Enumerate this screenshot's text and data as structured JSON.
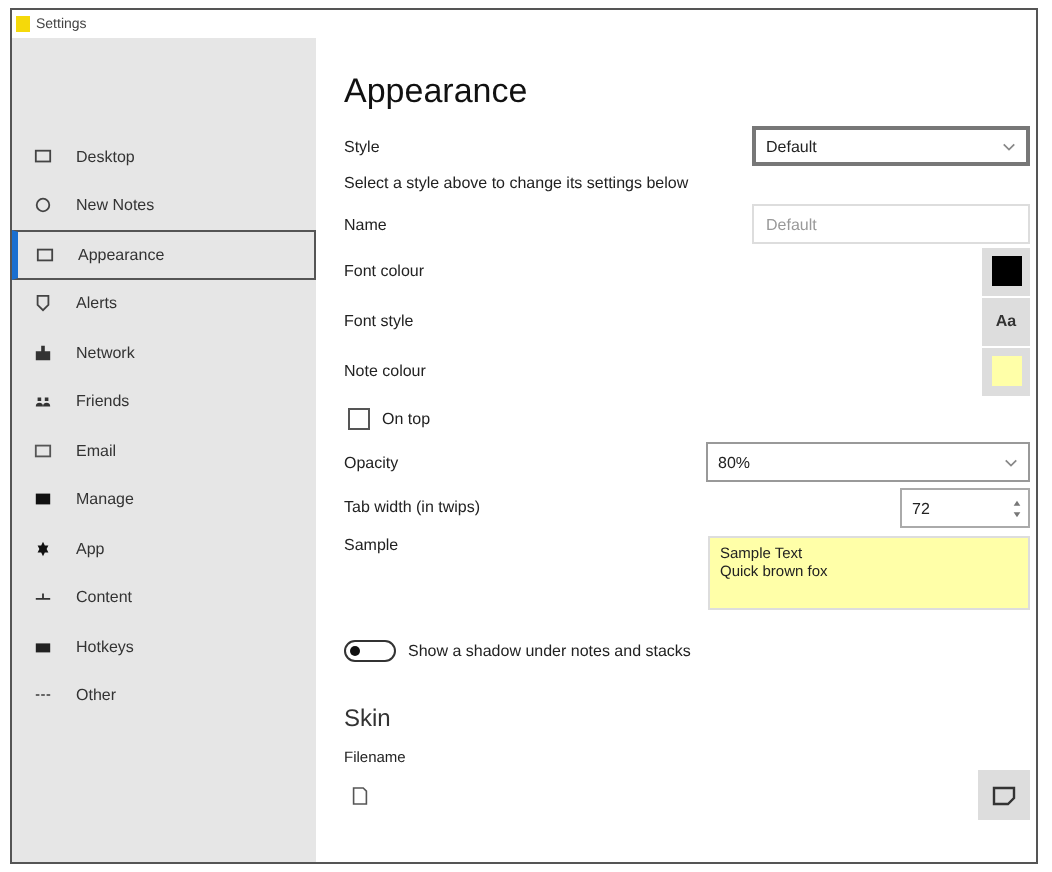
{
  "window": {
    "title": "Settings"
  },
  "sidebar": {
    "items": [
      {
        "label": "Desktop",
        "selected": false
      },
      {
        "label": "New Notes",
        "selected": false
      },
      {
        "label": "Appearance",
        "selected": true
      },
      {
        "label": "Alerts",
        "selected": false
      },
      {
        "label": "Network",
        "selected": false
      },
      {
        "label": "Friends",
        "selected": false
      },
      {
        "label": "Email",
        "selected": false
      },
      {
        "label": "Manage",
        "selected": false
      },
      {
        "label": "App",
        "selected": false
      },
      {
        "label": "Content",
        "selected": false
      },
      {
        "label": "Hotkeys",
        "selected": false
      },
      {
        "label": "Other",
        "selected": false
      }
    ]
  },
  "page": {
    "heading": "Appearance",
    "style": {
      "label": "Style",
      "value": "Default"
    },
    "hint": "Select a style above to change its settings below",
    "name": {
      "label": "Name",
      "placeholder": "Default"
    },
    "font_colour": {
      "label": "Font colour",
      "color": "#000000"
    },
    "font_style": {
      "label": "Font style",
      "button": "Aa"
    },
    "note_colour": {
      "label": "Note colour",
      "color": "#ffffa8"
    },
    "on_top": {
      "label": "On top",
      "checked": false
    },
    "opacity": {
      "label": "Opacity",
      "value": "80%"
    },
    "tab_width": {
      "label": "Tab width (in twips)",
      "value": "72"
    },
    "sample": {
      "label": "Sample",
      "lines": [
        "Sample Text",
        "Quick brown fox"
      ]
    },
    "shadow": {
      "label": "Show a shadow under notes and stacks",
      "on": false
    },
    "skin": {
      "heading": "Skin",
      "filename_label": "Filename"
    }
  }
}
